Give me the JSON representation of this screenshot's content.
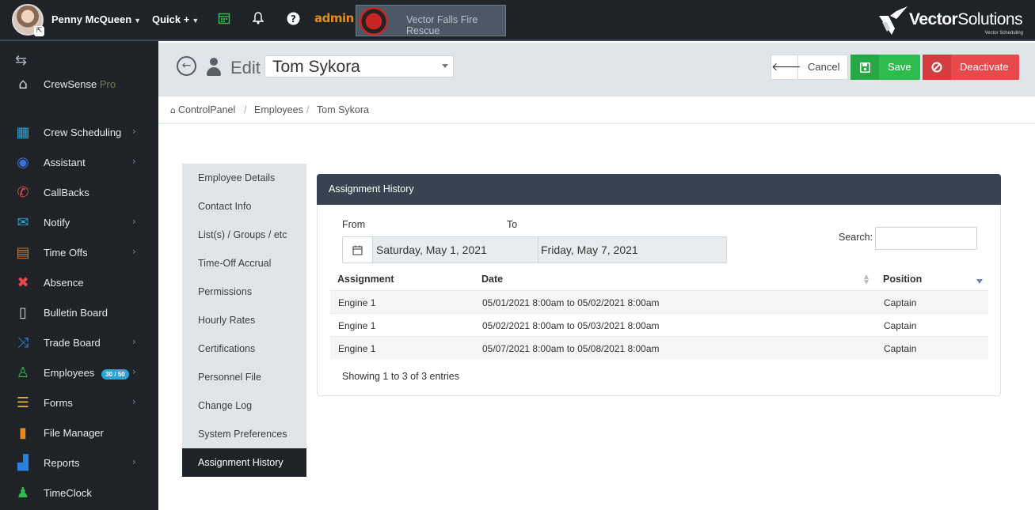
{
  "topbar": {
    "user_name": "Penny McQueen",
    "quick_label": "Quick +",
    "admin_label": "admin",
    "department": "Vector Falls Fire Rescue",
    "logo_main": "Vector",
    "logo_accent": "Solutions",
    "logo_sub": "Vector Scheduling"
  },
  "sidebar": {
    "brand": "CrewSense",
    "brand_suffix": "Pro",
    "items": [
      {
        "label": "Crew Scheduling",
        "icon": "calendar-icon",
        "color": "#2ba3d4"
      },
      {
        "label": "Assistant",
        "icon": "assistant-icon",
        "color": "#3b6fd8"
      },
      {
        "label": "CallBacks",
        "icon": "phone-icon",
        "color": "#e8494a"
      },
      {
        "label": "Notify",
        "icon": "envelope-icon",
        "color": "#2ba3d4"
      },
      {
        "label": "Time Offs",
        "icon": "suitcase-icon",
        "color": "#c27a3a"
      },
      {
        "label": "Absence",
        "icon": "absence-icon",
        "color": "#e8494a"
      },
      {
        "label": "Bulletin Board",
        "icon": "document-icon",
        "color": "#cfd6dc"
      },
      {
        "label": "Trade Board",
        "icon": "shuffle-icon",
        "color": "#2b7fe0"
      },
      {
        "label": "Employees",
        "icon": "user-icon",
        "color": "#2dbd4e",
        "badge": "30 / 50"
      },
      {
        "label": "Forms",
        "icon": "forms-icon",
        "color": "#e8b13a"
      },
      {
        "label": "File Manager",
        "icon": "file-icon",
        "color": "#e88a1a"
      },
      {
        "label": "Reports",
        "icon": "bar-chart-icon",
        "color": "#2b7fe0"
      },
      {
        "label": "TimeClock",
        "icon": "timeclock-icon",
        "color": "#2dbd4e"
      }
    ]
  },
  "header": {
    "edit_label": "Edit",
    "employee_selected": "Tom Sykora",
    "cancel_label": "Cancel",
    "save_label": "Save",
    "deactivate_label": "Deactivate"
  },
  "breadcrumb": [
    "ControlPanel",
    "Employees",
    "Tom Sykora"
  ],
  "tabs": [
    "Employee Details",
    "Contact Info",
    "List(s) / Groups / etc",
    "Time-Off Accrual",
    "Permissions",
    "Hourly Rates",
    "Certifications",
    "Personnel File",
    "Change Log",
    "System Preferences",
    "Assignment History"
  ],
  "panel": {
    "title": "Assignment History",
    "from_label": "From",
    "to_label": "To",
    "from_date": "Saturday, May 1, 2021",
    "to_date": "Friday, May 7, 2021",
    "search_label": "Search:",
    "search_value": "",
    "columns": [
      "Assignment",
      "Date",
      "Position"
    ],
    "rows": [
      {
        "assignment": "Engine 1",
        "date": "05/01/2021 8:00am to 05/02/2021 8:00am",
        "position": "Captain"
      },
      {
        "assignment": "Engine 1",
        "date": "05/02/2021 8:00am to 05/03/2021 8:00am",
        "position": "Captain"
      },
      {
        "assignment": "Engine 1",
        "date": "05/07/2021 8:00am to 05/08/2021 8:00am",
        "position": "Captain"
      }
    ],
    "showing": "Showing 1 to 3 of 3 entries"
  }
}
